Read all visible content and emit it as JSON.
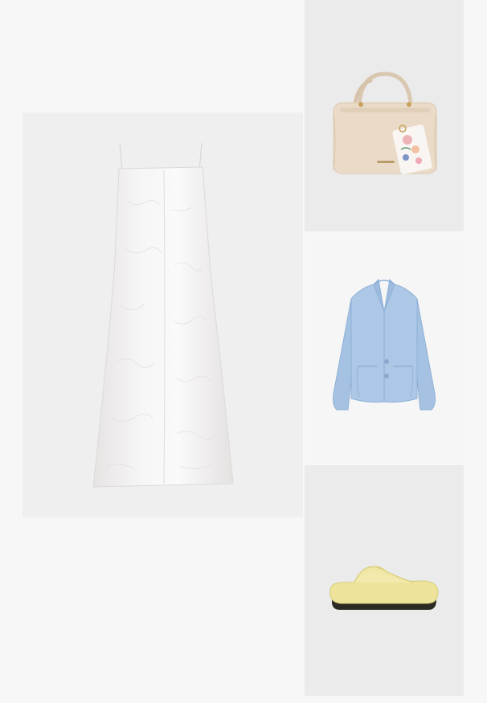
{
  "outfit": {
    "items": [
      {
        "id": "dress",
        "icon": "white-satin-slip-dress",
        "color": "#f4f2f1"
      },
      {
        "id": "bag",
        "icon": "beige-handbag-with-floral-scarf",
        "color": "#eadbc8"
      },
      {
        "id": "blazer",
        "icon": "light-blue-blazer",
        "color": "#a9c4e2"
      },
      {
        "id": "sandal",
        "icon": "yellow-flip-flop-sandal",
        "color": "#ede39a"
      }
    ]
  }
}
